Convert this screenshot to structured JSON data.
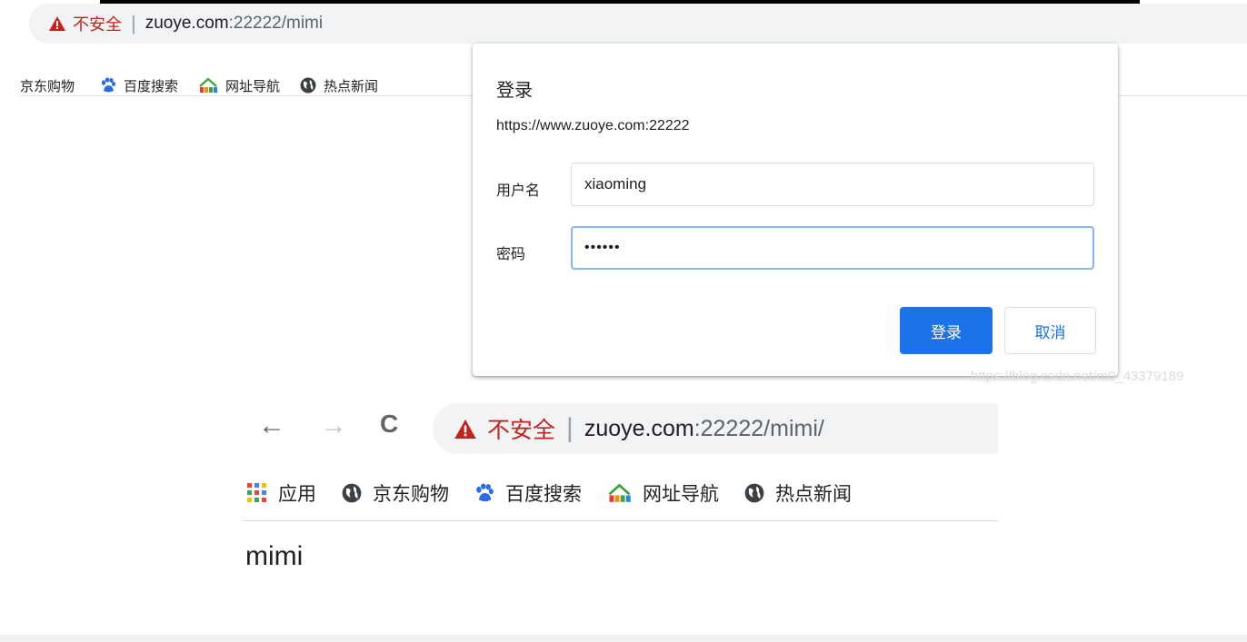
{
  "browser_top": {
    "security_label": "不安全",
    "separator": "|",
    "url_host": "zuoye.com",
    "url_path": ":22222/mimi",
    "bookmarks": [
      {
        "label": "京东购物",
        "icon": "none"
      },
      {
        "label": "百度搜索",
        "icon": "baidu-paw-icon"
      },
      {
        "label": "网址导航",
        "icon": "2345-house-icon"
      },
      {
        "label": "热点新闻",
        "icon": "globe-icon"
      }
    ]
  },
  "dialog": {
    "title": "登录",
    "origin": "https://www.zuoye.com:22222",
    "username_label": "用户名",
    "username_value": "xiaoming",
    "password_label": "密码",
    "password_value": "••••••",
    "login_button": "登录",
    "cancel_button": "取消"
  },
  "watermark": "https://blog.csdn.net/m0_43379189",
  "browser_bottom": {
    "back_icon": "←",
    "forward_icon": "→",
    "reload_icon": "C",
    "security_label": "不安全",
    "separator": "|",
    "url_host": "zuoye.com",
    "url_path": ":22222/mimi/",
    "bookmarks": [
      {
        "label": "应用",
        "icon": "apps-grid-icon"
      },
      {
        "label": "京东购物",
        "icon": "globe-icon"
      },
      {
        "label": "百度搜索",
        "icon": "baidu-paw-icon"
      },
      {
        "label": "网址导航",
        "icon": "2345-house-icon"
      },
      {
        "label": "热点新闻",
        "icon": "globe-icon"
      }
    ],
    "page_text": "mimi"
  },
  "colors": {
    "warning_red": "#c5221f",
    "accent_blue": "#1a73e8",
    "focus_blue": "#8ab4f8",
    "omnibox_gray": "#f1f3f4"
  }
}
